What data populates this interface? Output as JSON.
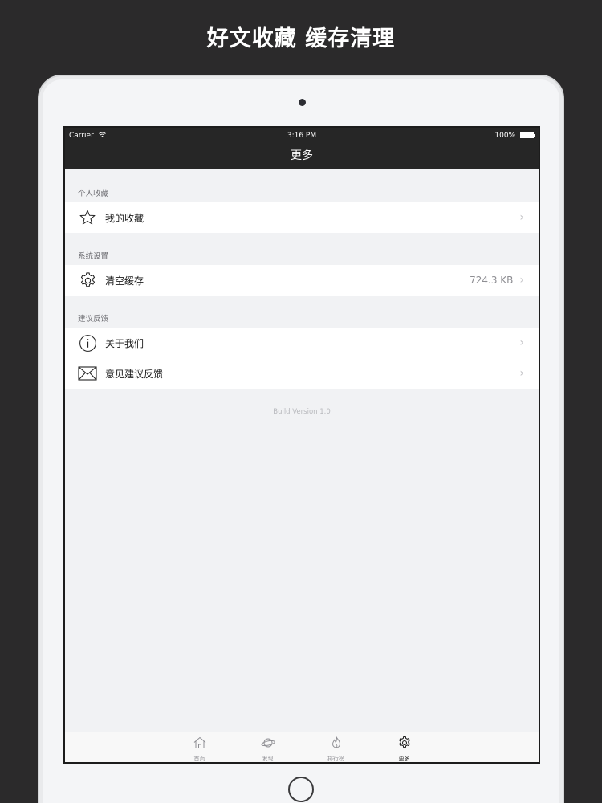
{
  "promo": {
    "title": "好文收藏 缓存清理"
  },
  "status_bar": {
    "carrier": "Carrier",
    "time": "3:16 PM",
    "battery": "100%"
  },
  "nav": {
    "title": "更多"
  },
  "sections": [
    {
      "header": "个人收藏",
      "items": [
        {
          "label": "我的收藏",
          "icon": "star-icon",
          "detail": ""
        }
      ]
    },
    {
      "header": "系统设置",
      "items": [
        {
          "label": "清空缓存",
          "icon": "gear-icon",
          "detail": "724.3 KB"
        }
      ]
    },
    {
      "header": "建议反馈",
      "items": [
        {
          "label": "关于我们",
          "icon": "info-icon",
          "detail": ""
        },
        {
          "label": "意见建议反馈",
          "icon": "mail-icon",
          "detail": ""
        }
      ]
    }
  ],
  "footer": {
    "build_version": "Build Version 1.0"
  },
  "tabs": [
    {
      "label": "首页",
      "icon": "home-icon",
      "active": false
    },
    {
      "label": "发现",
      "icon": "planet-icon",
      "active": false
    },
    {
      "label": "排行榜",
      "icon": "fire-icon",
      "active": false
    },
    {
      "label": "更多",
      "icon": "gear-icon",
      "active": true
    }
  ],
  "colors": {
    "nav_background": "#262626",
    "page_background": "#2b2a2b",
    "table_background": "#f1f2f4"
  }
}
